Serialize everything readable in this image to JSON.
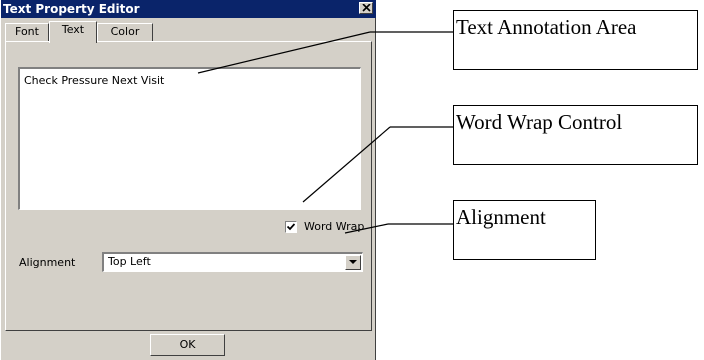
{
  "window": {
    "title": "Text Property Editor",
    "close_glyph": "✕"
  },
  "tabs": [
    {
      "label": "Font",
      "active": false
    },
    {
      "label": "Text",
      "active": true
    },
    {
      "label": "Color",
      "active": false
    }
  ],
  "text_area": {
    "value": "Check Pressure Next Visit"
  },
  "word_wrap": {
    "label": "Word Wrap",
    "checked": true
  },
  "alignment": {
    "label": "Alignment",
    "value": "Top Left"
  },
  "buttons": {
    "ok": "OK"
  },
  "callouts": {
    "text_area": "Text Annotation Area",
    "word_wrap": "Word Wrap Control",
    "alignment": "Alignment"
  },
  "colors": {
    "titlebar": "#0a246a",
    "dialog_bg": "#d4d0c8"
  }
}
